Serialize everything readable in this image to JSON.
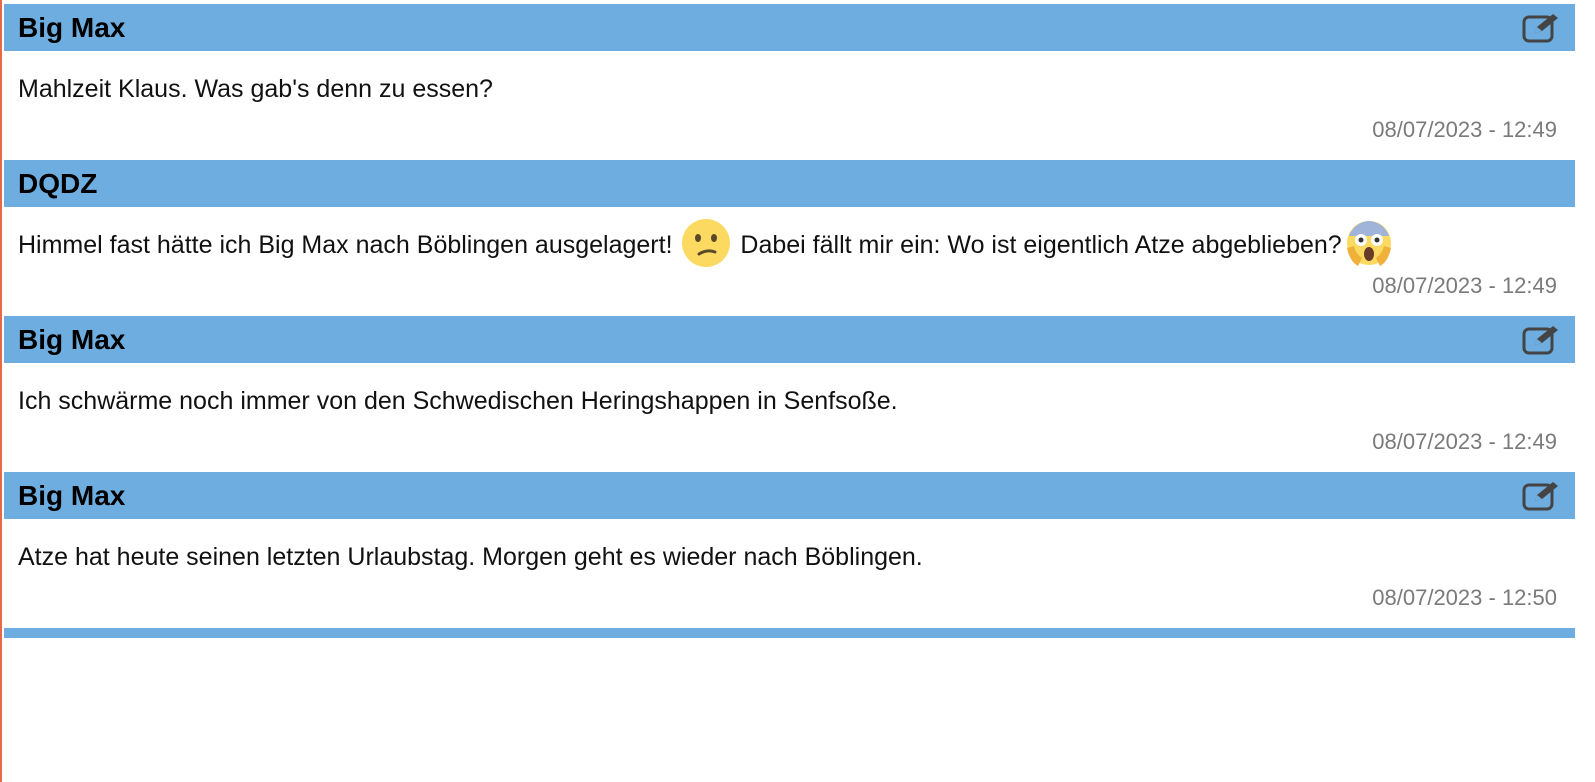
{
  "colors": {
    "header_bg": "#6eaddf",
    "timestamp": "#7a7a7a",
    "left_border": "#e8684a"
  },
  "messages": [
    {
      "author": "Big Max",
      "editable": true,
      "text": "Mahlzeit Klaus. Was gab's denn zu essen?",
      "timestamp": "08/07/2023 - 12:49"
    },
    {
      "author": "DQDZ",
      "editable": false,
      "text_part1": "Himmel fast hätte ich Big Max nach Böblingen ausgelagert! ",
      "emoji1": "confused-face-icon",
      "text_part2": " Dabei fällt mir ein: Wo ist eigentlich Atze abgeblieben?",
      "emoji2": "face-screaming-in-fear-icon",
      "timestamp": "08/07/2023 - 12:49"
    },
    {
      "author": "Big Max",
      "editable": true,
      "text": "Ich schwärme noch immer von den Schwedischen Heringshappen in Senfsoße.",
      "timestamp": "08/07/2023 - 12:49"
    },
    {
      "author": "Big Max",
      "editable": true,
      "text": "Atze hat heute seinen letzten Urlaubstag. Morgen geht es wieder nach Böblingen.",
      "timestamp": "08/07/2023 - 12:50"
    }
  ]
}
